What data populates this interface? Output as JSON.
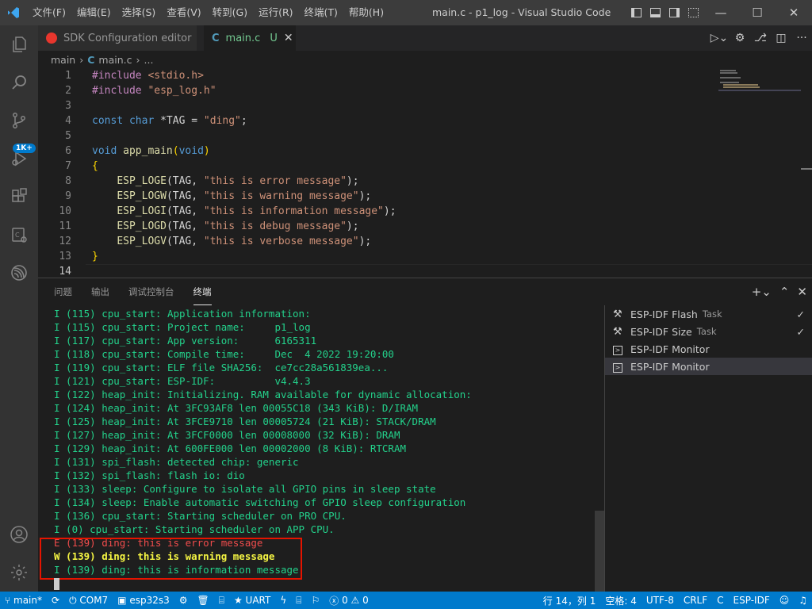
{
  "window": {
    "title": "main.c - p1_log - Visual Studio Code"
  },
  "menu": [
    "文件(F)",
    "编辑(E)",
    "选择(S)",
    "查看(V)",
    "转到(G)",
    "运行(R)",
    "终端(T)",
    "帮助(H)"
  ],
  "activity_bar": {
    "badge": "1K+",
    "items": [
      "explorer-icon",
      "search-icon",
      "source-control-icon",
      "run-debug-icon",
      "extensions-icon",
      "esp-idf-components-icon",
      "espressif-icon",
      "account-icon",
      "manage-gear-icon"
    ]
  },
  "tabs": [
    {
      "label": "SDK Configuration editor",
      "icon": "espressif-icon"
    },
    {
      "label": "main.c",
      "icon": "c-file-icon",
      "status": "U"
    }
  ],
  "breadcrumb": {
    "folder": "main",
    "file": "main.c",
    "more": "..."
  },
  "editor": {
    "line_numbers": [
      "1",
      "2",
      "3",
      "4",
      "5",
      "6",
      "7",
      "8",
      "9",
      "10",
      "11",
      "12",
      "13",
      "14"
    ],
    "current_line": 14
  },
  "panel": {
    "tabs": [
      "问题",
      "输出",
      "调试控制台",
      "终端"
    ],
    "active_tab": "终端",
    "terminal_lines": [
      {
        "text": "I (115) cpu_start: Application information:",
        "level": "info"
      },
      {
        "text": "I (115) cpu_start: Project name:     p1_log",
        "level": "info"
      },
      {
        "text": "I (117) cpu_start: App version:      6165311",
        "level": "info"
      },
      {
        "text": "I (118) cpu_start: Compile time:     Dec  4 2022 19:20:00",
        "level": "info"
      },
      {
        "text": "I (119) cpu_start: ELF file SHA256:  ce7cc28a561839ea...",
        "level": "info"
      },
      {
        "text": "I (121) cpu_start: ESP-IDF:          v4.4.3",
        "level": "info"
      },
      {
        "text": "I (122) heap_init: Initializing. RAM available for dynamic allocation:",
        "level": "info"
      },
      {
        "text": "I (124) heap_init: At 3FC93AF8 len 00055C18 (343 KiB): D/IRAM",
        "level": "info"
      },
      {
        "text": "I (125) heap_init: At 3FCE9710 len 00005724 (21 KiB): STACK/DRAM",
        "level": "info"
      },
      {
        "text": "I (127) heap_init: At 3FCF0000 len 00008000 (32 KiB): DRAM",
        "level": "info"
      },
      {
        "text": "I (129) heap_init: At 600FE000 len 00002000 (8 KiB): RTCRAM",
        "level": "info"
      },
      {
        "text": "I (131) spi_flash: detected chip: generic",
        "level": "info"
      },
      {
        "text": "I (132) spi_flash: flash io: dio",
        "level": "info"
      },
      {
        "text": "I (133) sleep: Configure to isolate all GPIO pins in sleep state",
        "level": "info"
      },
      {
        "text": "I (134) sleep: Enable automatic switching of GPIO sleep configuration",
        "level": "info"
      },
      {
        "text": "I (136) cpu_start: Starting scheduler on PRO CPU.",
        "level": "info"
      },
      {
        "text": "I (0) cpu_start: Starting scheduler on APP CPU.",
        "level": "info"
      },
      {
        "text": "E (139) ding: this is error message",
        "level": "error"
      },
      {
        "text": "W (139) ding: this is warning message",
        "level": "warn"
      },
      {
        "text": "I (139) ding: this is information message",
        "level": "info"
      }
    ],
    "terminal_list": [
      {
        "label": "ESP-IDF Flash",
        "tag": "Task",
        "icon": "tools-icon",
        "check": "✓"
      },
      {
        "label": "ESP-IDF Size",
        "tag": "Task",
        "icon": "tools-icon",
        "check": "✓"
      },
      {
        "label": "ESP-IDF Monitor",
        "tag": "",
        "icon": "terminal-icon",
        "check": ""
      },
      {
        "label": "ESP-IDF Monitor",
        "tag": "",
        "icon": "terminal-icon",
        "check": ""
      }
    ]
  },
  "statusbar": {
    "branch": "main*",
    "port": "COM7",
    "target": "esp32s3",
    "uart": "UART",
    "errors": "0",
    "warnings": "0",
    "position": "行 14，列 1",
    "spaces": "空格: 4",
    "encoding": "UTF-8",
    "eol": "CRLF",
    "language": "C",
    "idf": "ESP-IDF"
  },
  "colors": {
    "accent": "#007acc",
    "error": "#f14c4c",
    "warn": "#f5f543",
    "info": "#23d18b",
    "highlight_box": "#e51400"
  }
}
